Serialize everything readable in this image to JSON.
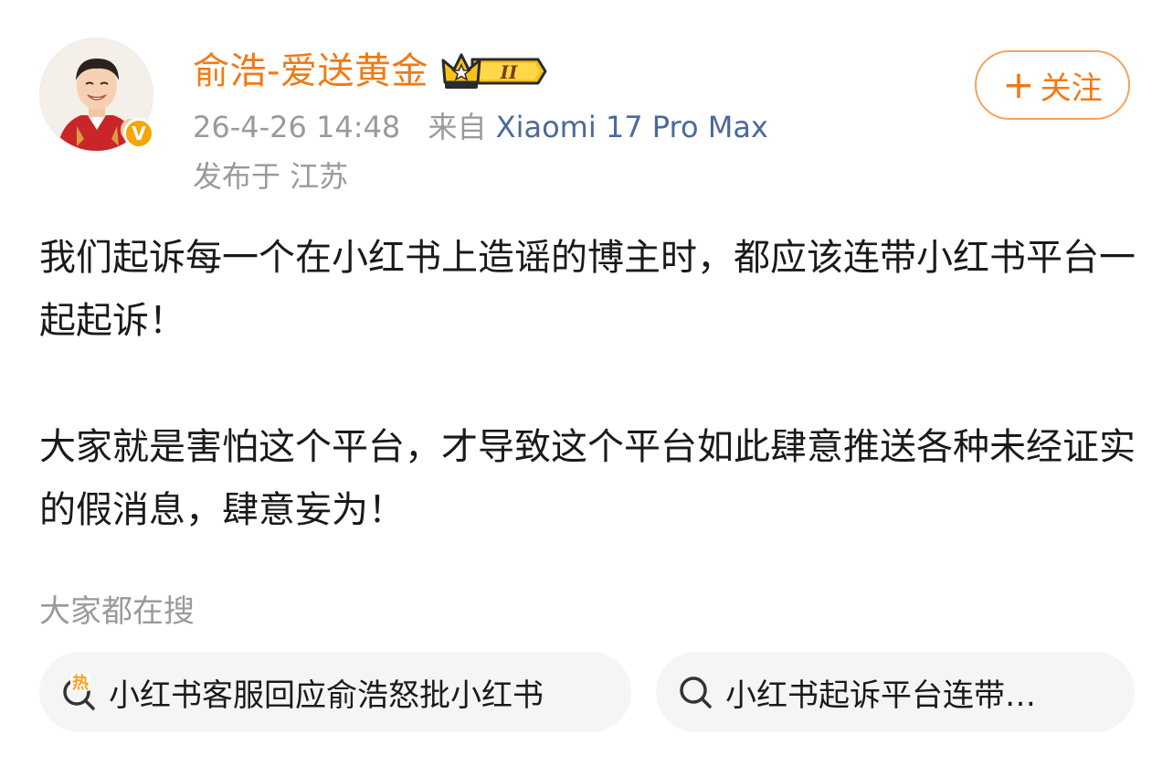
{
  "author": {
    "name": "俞浩-爱送黄金",
    "verified_mark": "V",
    "level_badge_text": "II",
    "follow_label": "关注",
    "follow_plus": "+"
  },
  "meta": {
    "timestamp": "26-4-26 14:48",
    "source_prefix": "来自",
    "device": "Xiaomi 17 Pro Max",
    "location": "发布于 江苏"
  },
  "post": {
    "paragraph1": "我们起诉每一个在小红书上造谣的博主时，都应该连带小红书平台一起起诉！",
    "paragraph2": "大家就是害怕这个平台，才导致这个平台如此肆意推送各种未经证实的假消息，肆意妄为！"
  },
  "search_section": {
    "title": "大家都在搜",
    "chips": [
      {
        "label": "小红书客服回应俞浩怒批小红书",
        "icon": "hot-search-icon",
        "hot_text": "热"
      },
      {
        "label": "小红书起诉平台连带…",
        "icon": "search-icon"
      }
    ]
  },
  "colors": {
    "accent_orange": "#f07a16",
    "device_blue": "#4b6a9a",
    "muted_gray": "#9a9a9a",
    "badge_gold": "#f7a600"
  }
}
